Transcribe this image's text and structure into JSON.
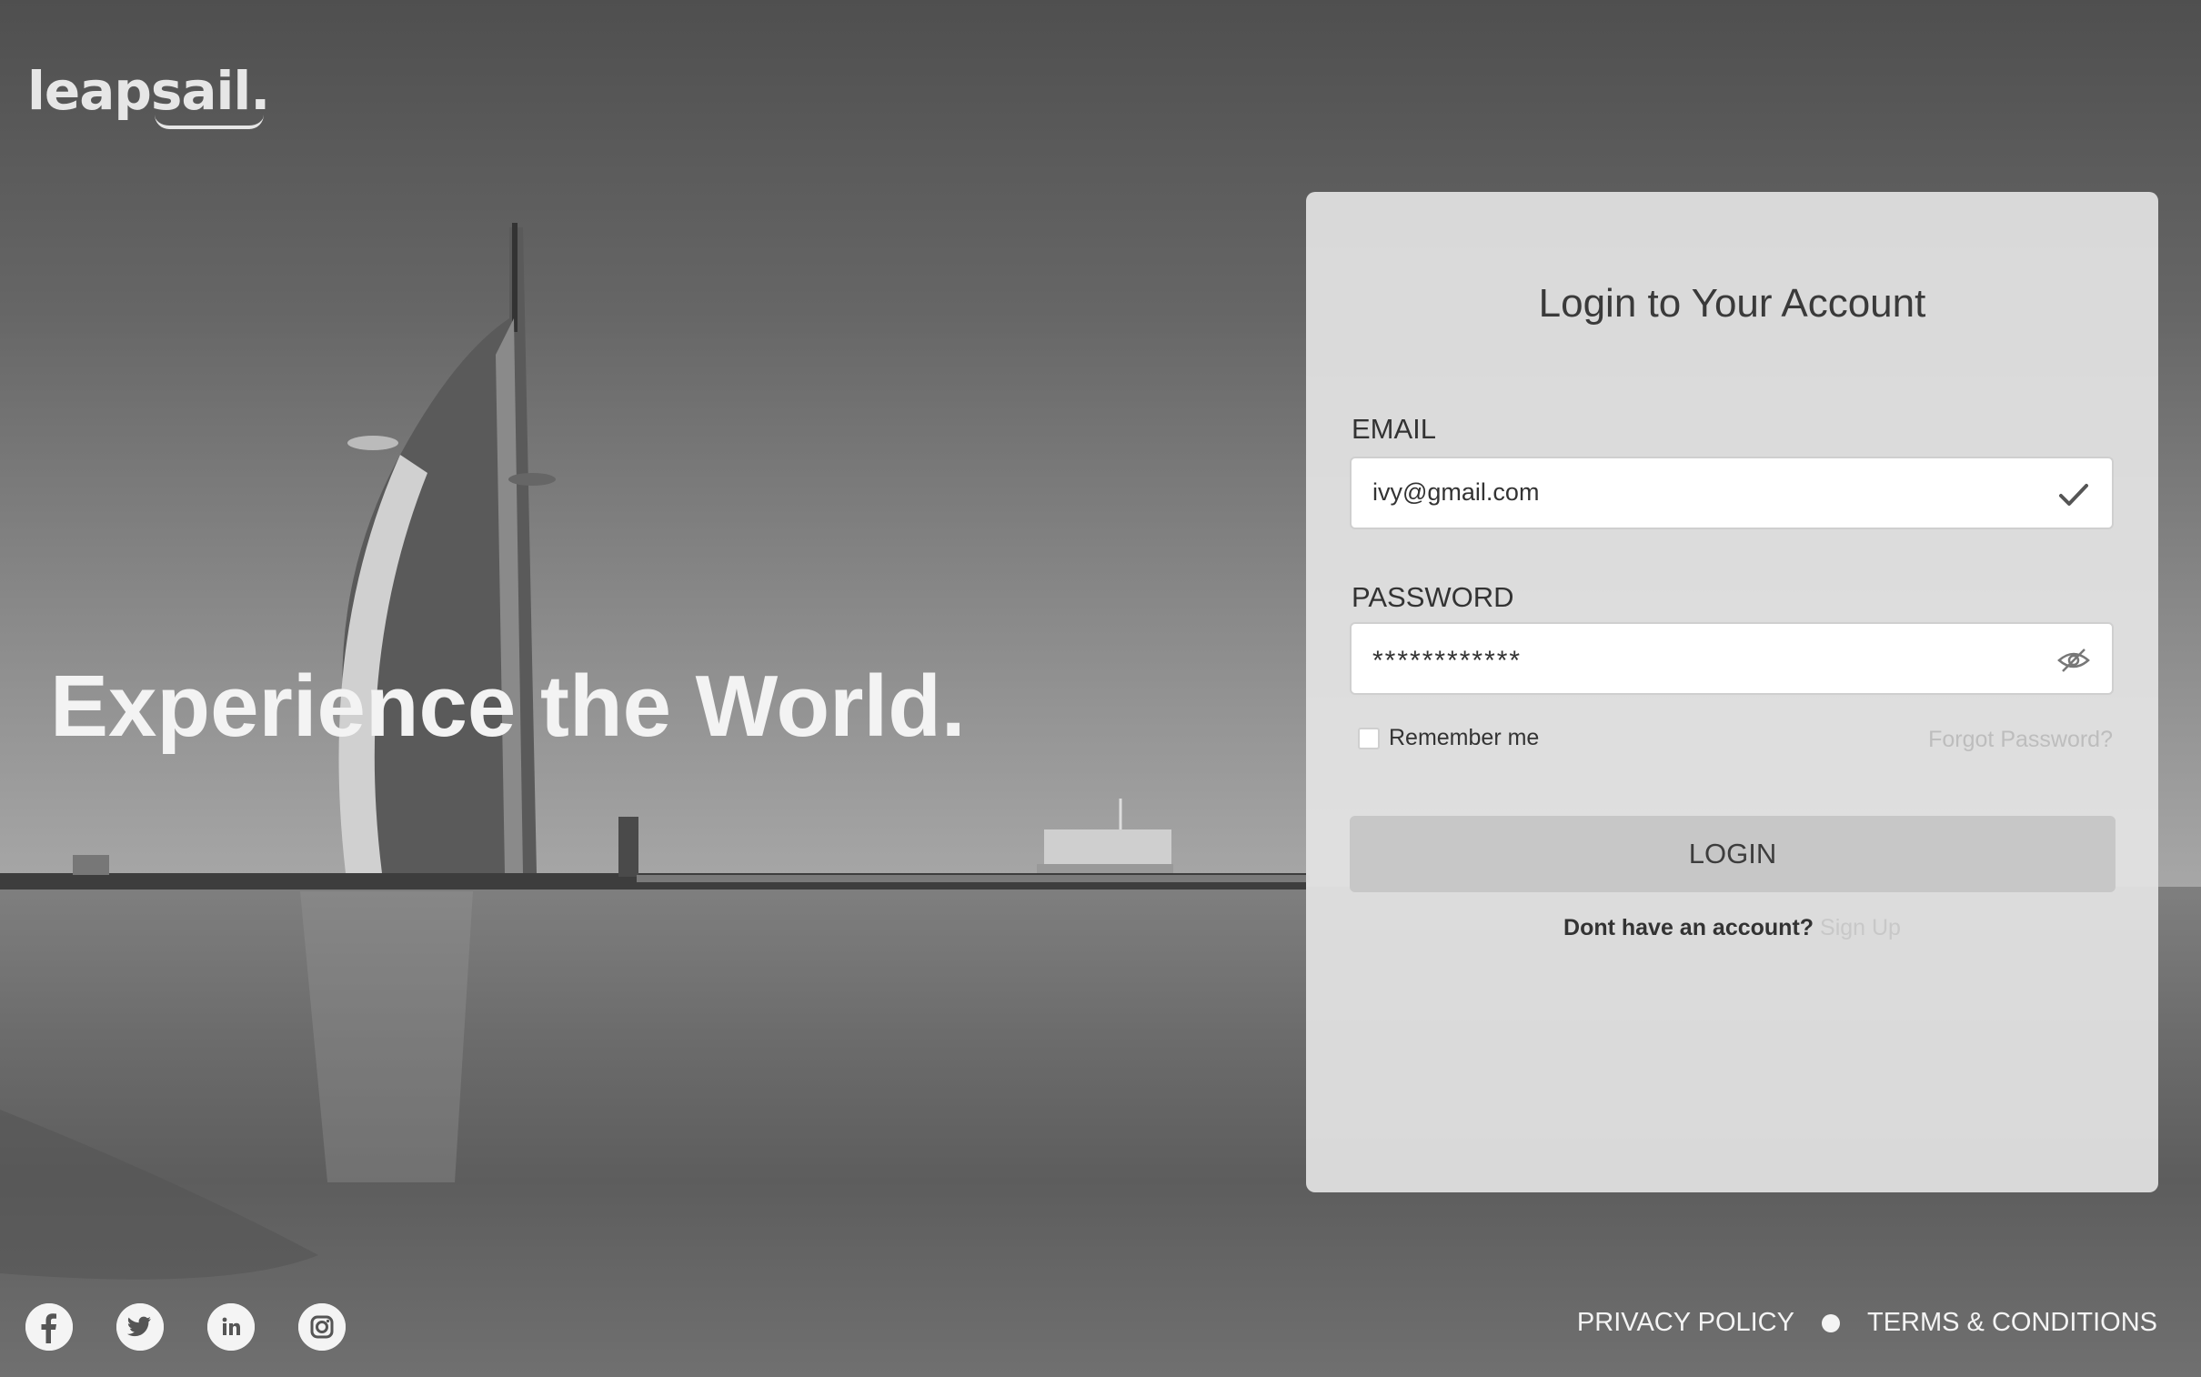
{
  "brand": {
    "logo_text": "leapsail."
  },
  "hero": {
    "headline": "Experience the World."
  },
  "login": {
    "title": "Login to Your Account",
    "email_label": "EMAIL",
    "email_value": "ivy@gmail.com",
    "password_label": "PASSWORD",
    "password_value": "************",
    "remember_label": "Remember me",
    "remember_checked": false,
    "forgot_label": "Forgot Password?",
    "login_button": "LOGIN",
    "signup_prompt": "Dont have an account?",
    "signup_link": "Sign Up"
  },
  "footer": {
    "socials": [
      "facebook-icon",
      "twitter-icon",
      "linkedin-icon",
      "instagram-icon"
    ],
    "privacy": "PRIVACY POLICY",
    "terms": "TERMS & CONDITIONS"
  }
}
